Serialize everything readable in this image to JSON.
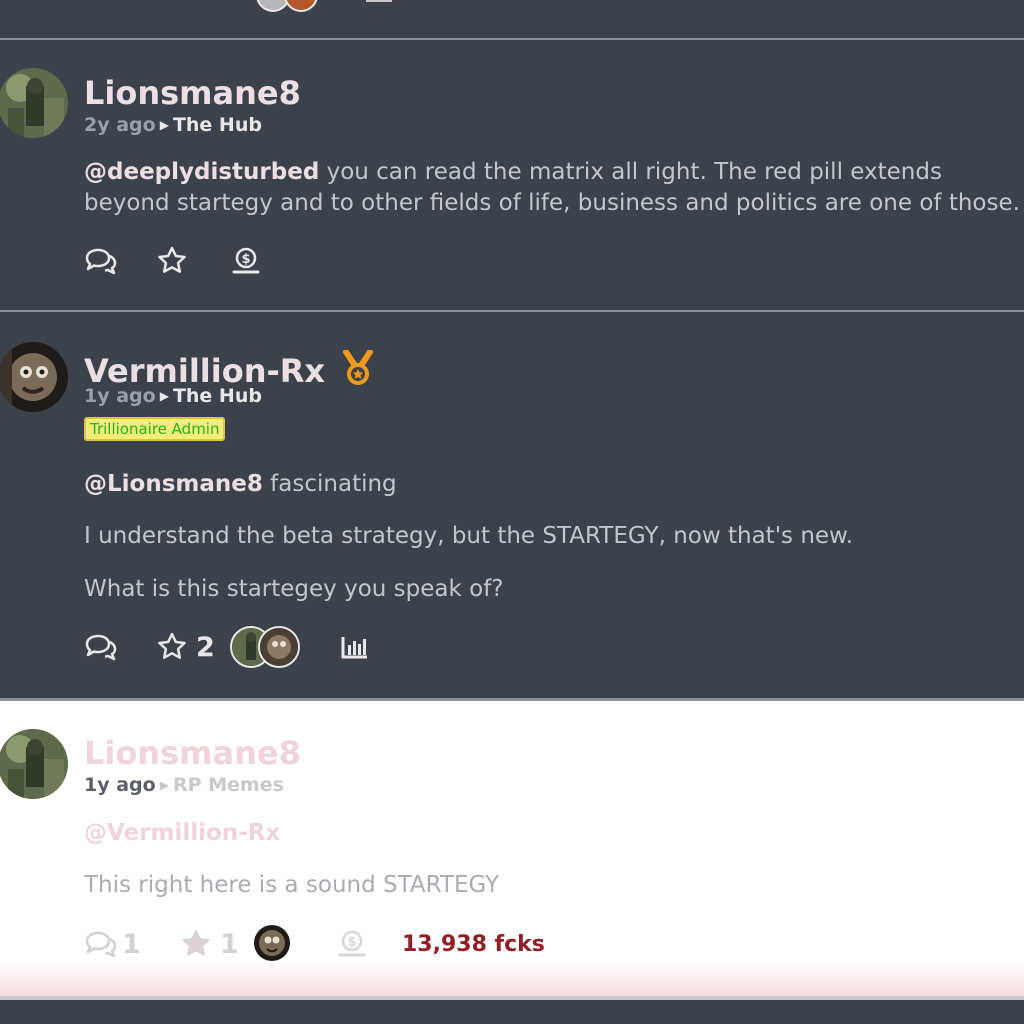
{
  "posts": [
    {
      "username": "Lionsmane8",
      "time": "2y ago",
      "community": "The Hub",
      "mention": "@deeplydisturbed",
      "text": " you can read the matrix all right. The red pill extends beyond startegy and to other fields of life, business and politics are one of those."
    },
    {
      "username": "Vermillion-Rx",
      "time": "1y ago",
      "community": "The Hub",
      "badge": "Trillionaire Admin",
      "mention": "@Lionsmane8",
      "mention_text": " fascinating",
      "paragraph2": "I understand the beta strategy, but the STARTEGY, now that's new.",
      "paragraph3": "What is this startegey you speak of?",
      "star_count": "2"
    },
    {
      "username": "Lionsmane8",
      "time": "1y ago",
      "community": "RP Memes",
      "mention": "@Vermillion-Rx",
      "text": "This right here is a sound STARTEGY",
      "reply_count": "1",
      "star_count": "1",
      "tip_total": "13,938 fcks"
    }
  ],
  "colors": {
    "background": "#3c424b",
    "light_background": "#ffffff",
    "badge_bg": "#f3ee7a",
    "badge_text": "#2bb01f",
    "tip_text": "#8f1f25",
    "medal": "#f09a1c"
  },
  "icons": [
    "reply-icon",
    "star-icon",
    "tip-icon",
    "stats-icon",
    "medal-icon"
  ]
}
